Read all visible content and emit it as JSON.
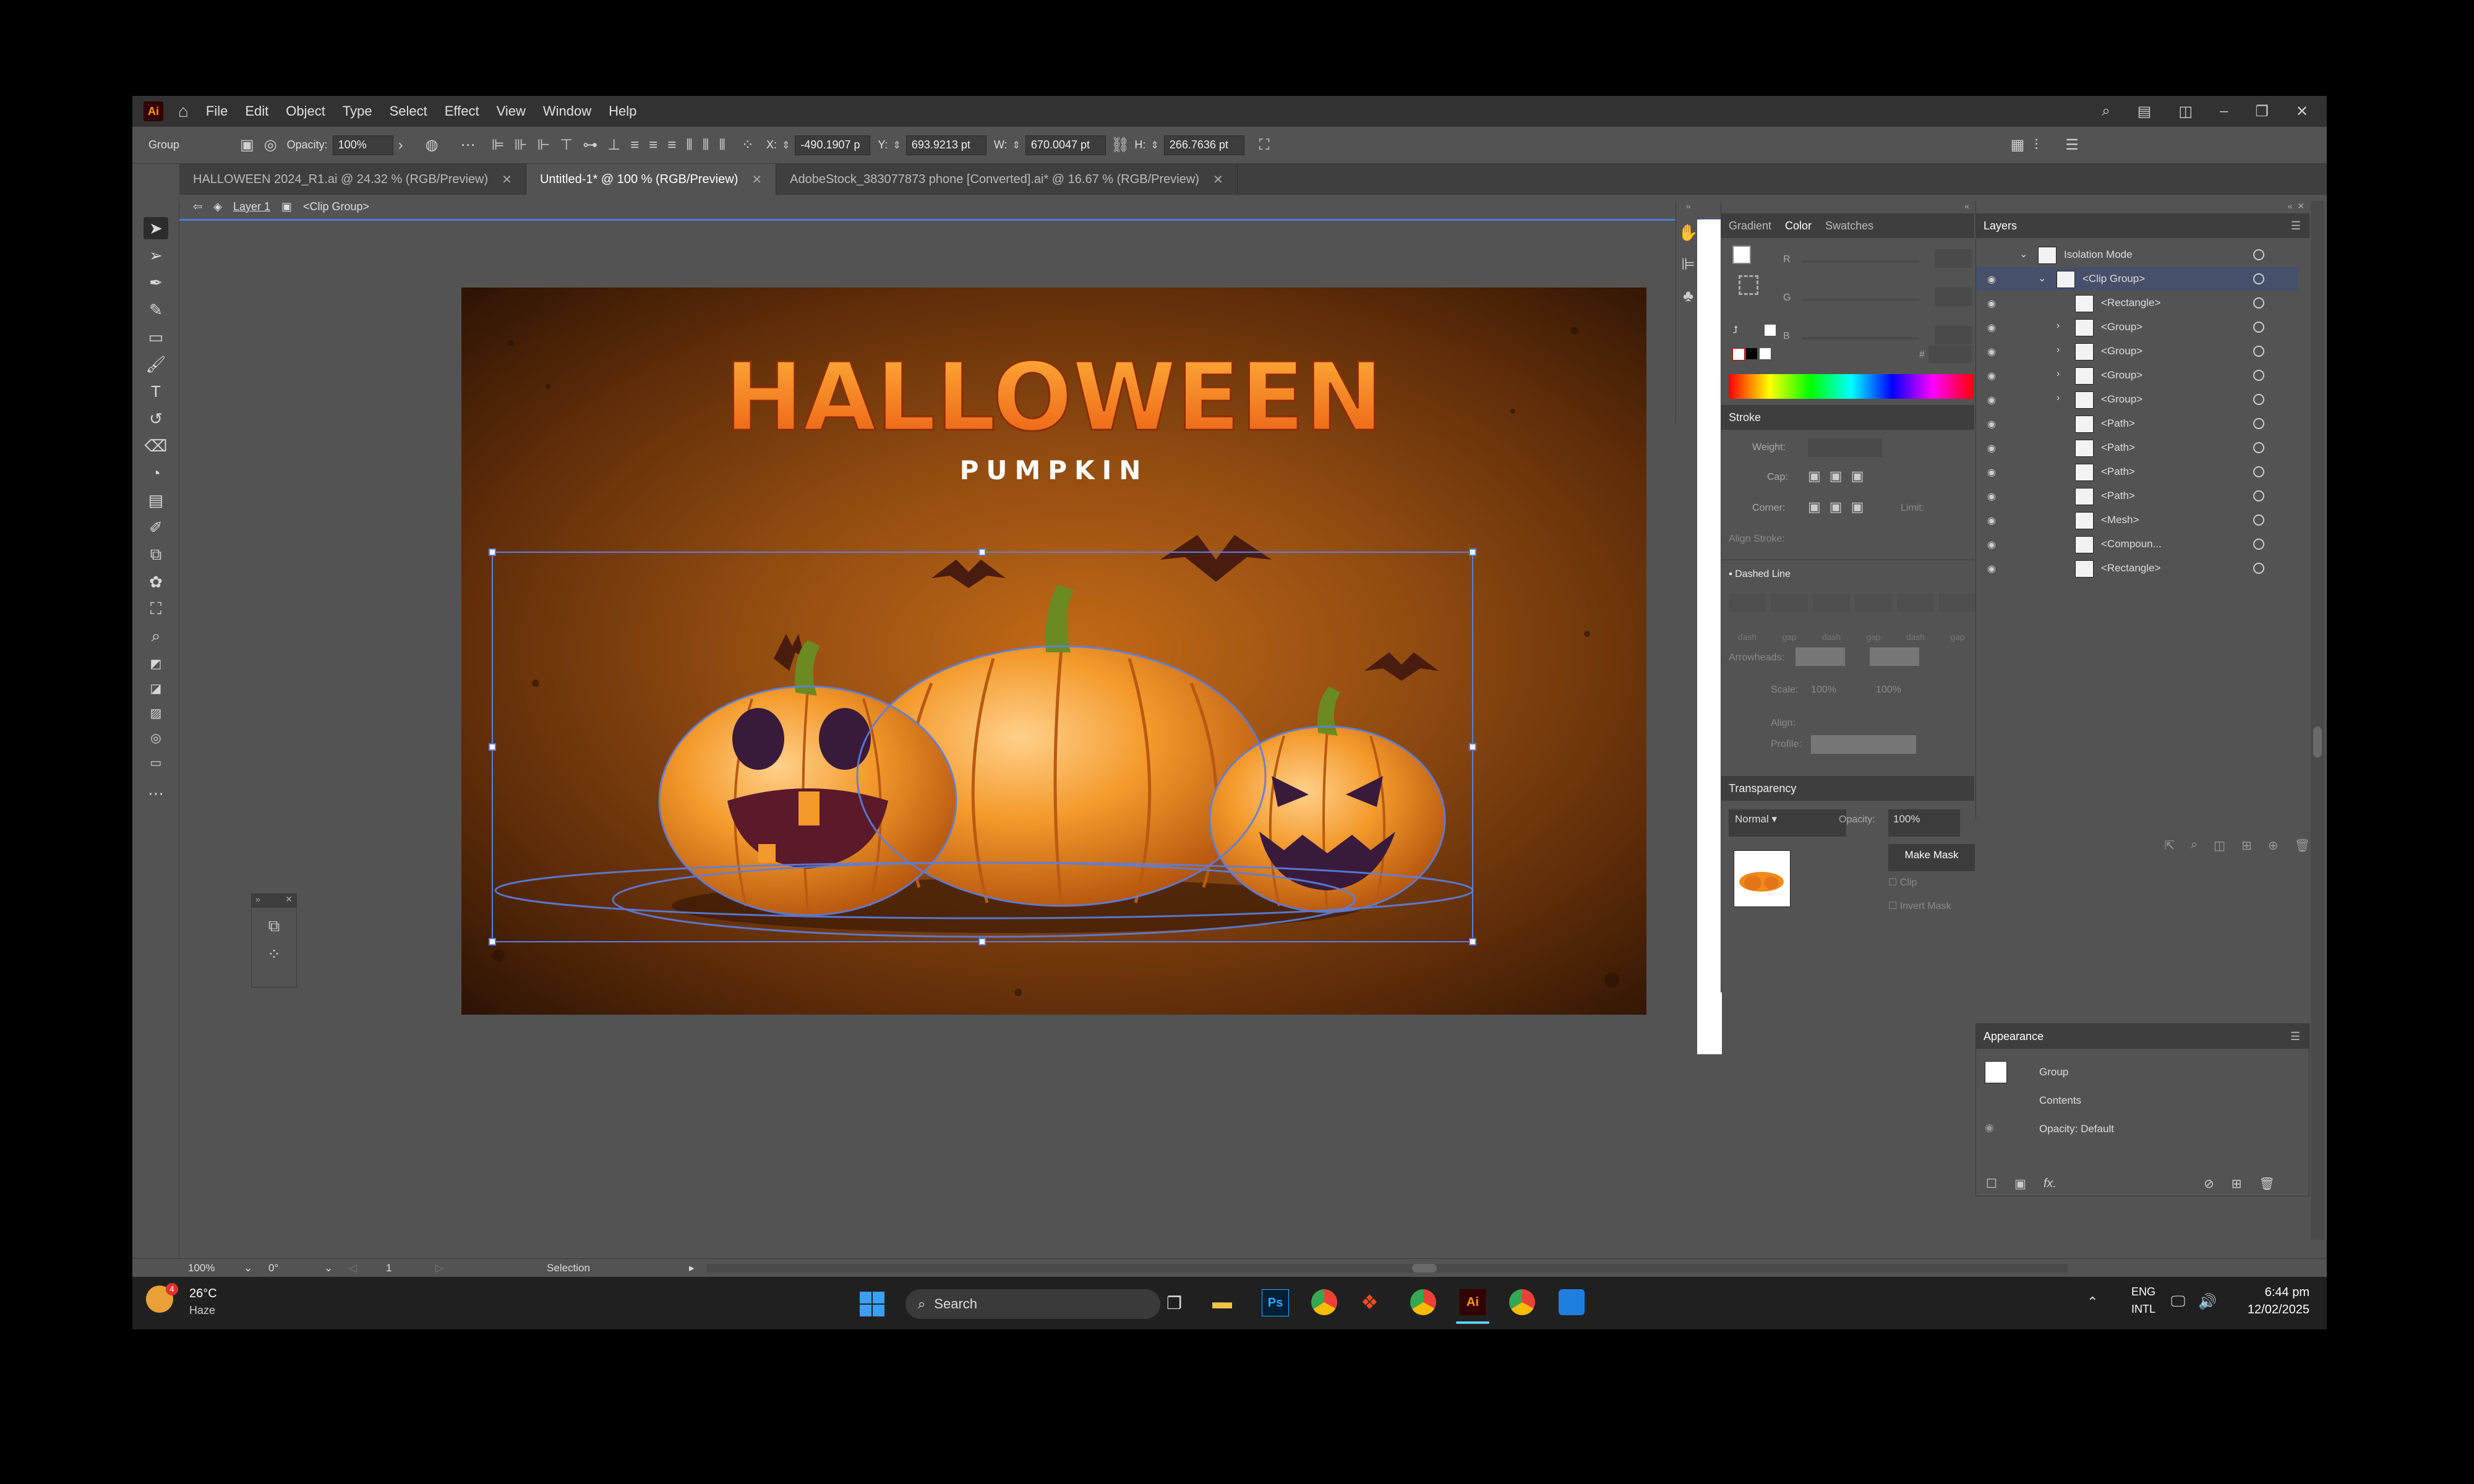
{
  "app": {
    "logo": "Ai",
    "menus": [
      "File",
      "Edit",
      "Object",
      "Type",
      "Select",
      "Effect",
      "View",
      "Window",
      "Help"
    ]
  },
  "control_bar": {
    "selection_type": "Group",
    "opacity_label": "Opacity:",
    "opacity_value": "100%",
    "x_label": "X:",
    "x_value": "-490.1907 p",
    "y_label": "Y:",
    "y_value": "693.9213 pt",
    "w_label": "W:",
    "w_value": "670.0047 pt",
    "h_label": "H:",
    "h_value": "266.7636 pt"
  },
  "tabs": [
    {
      "label": "HALLOWEEN 2024_R1.ai @ 24.32 % (RGB/Preview)",
      "active": false
    },
    {
      "label": "Untitled-1* @ 100 % (RGB/Preview)",
      "active": true
    },
    {
      "label": "AdobeStock_383077873 phone [Converted].ai* @ 16.67 % (RGB/Preview)",
      "active": false
    }
  ],
  "breadcrumb": {
    "layer": "Layer 1",
    "group": "<Clip Group>"
  },
  "artwork": {
    "title": "HALLOWEEN",
    "subtitle": "PUMPKIN"
  },
  "color_panel": {
    "tabs": [
      "Gradient",
      "Color",
      "Swatches"
    ],
    "channels": [
      "R",
      "G",
      "B"
    ],
    "hash": "#"
  },
  "stroke_panel": {
    "title": "Stroke",
    "weight_label": "Weight:",
    "cap_label": "Cap:",
    "corner_label": "Corner:",
    "limit_label": "Limit:",
    "align_label": "Align Stroke:",
    "dashed_label": "Dashed Line",
    "dash_cells": [
      "dash",
      "gap",
      "dash",
      "gap",
      "dash",
      "gap"
    ],
    "arrowheads_label": "Arrowheads:",
    "scale_label": "Scale:",
    "scale_a": "100%",
    "scale_b": "100%",
    "align_label2": "Align:",
    "profile_label": "Profile:"
  },
  "transparency_panel": {
    "title": "Transparency",
    "blend_mode": "Normal",
    "opacity_label": "Opacity:",
    "opacity_value": "100%",
    "make_mask": "Make Mask",
    "clip": "Clip",
    "invert_mask": "Invert Mask"
  },
  "layers_panel": {
    "title": "Layers",
    "rows": [
      {
        "name": "Isolation Mode",
        "indent": 0,
        "arrow": "v"
      },
      {
        "name": "<Clip Group>",
        "indent": 1,
        "arrow": "v"
      },
      {
        "name": "<Rectangle>",
        "indent": 2,
        "arrow": ""
      },
      {
        "name": "<Group>",
        "indent": 2,
        "arrow": ">"
      },
      {
        "name": "<Group>",
        "indent": 2,
        "arrow": ">"
      },
      {
        "name": "<Group>",
        "indent": 2,
        "arrow": ">"
      },
      {
        "name": "<Group>",
        "indent": 2,
        "arrow": ">"
      },
      {
        "name": "<Path>",
        "indent": 2,
        "arrow": ""
      },
      {
        "name": "<Path>",
        "indent": 2,
        "arrow": ""
      },
      {
        "name": "<Path>",
        "indent": 2,
        "arrow": ""
      },
      {
        "name": "<Path>",
        "indent": 2,
        "arrow": ""
      },
      {
        "name": "<Mesh>",
        "indent": 2,
        "arrow": ""
      },
      {
        "name": "<Compoun...",
        "indent": 2,
        "arrow": ""
      },
      {
        "name": "<Rectangle>",
        "indent": 2,
        "arrow": ""
      }
    ]
  },
  "appearance_panel": {
    "title": "Appearance",
    "group": "Group",
    "contents": "Contents",
    "opacity": "Opacity: Default",
    "fx": "fx."
  },
  "status_bar": {
    "zoom": "100%",
    "rotation": "0°",
    "artboard": "1",
    "tool": "Selection"
  },
  "taskbar": {
    "temperature": "26°C",
    "weather": "Haze",
    "weather_badge": "4",
    "search": "Search",
    "language": "ENG",
    "layout": "INTL",
    "time": "6:44 pm",
    "date": "12/02/2025",
    "ai_label": "Ai",
    "ps_label": "Ps"
  },
  "colors": {
    "ui_bg": "#535353",
    "panel_dark": "#3e3e3e",
    "selection_blue": "#4a7fd4",
    "pumpkin_orange": "#f08a1c",
    "taskbar": "#202020"
  }
}
